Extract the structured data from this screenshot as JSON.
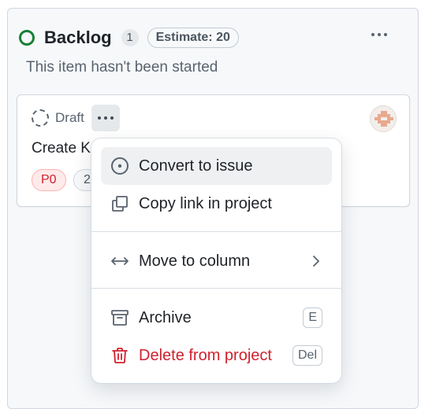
{
  "column": {
    "title": "Backlog",
    "count": "1",
    "estimate": "Estimate: 20",
    "description": "This item hasn't been started",
    "status_color": "#1a7f37"
  },
  "card": {
    "type_label": "Draft",
    "title": "Create K",
    "labels": [
      {
        "text": "P0",
        "color": "#cf222e"
      },
      {
        "text": "2"
      }
    ]
  },
  "menu": {
    "items": [
      {
        "label": "Convert to issue",
        "icon": "issue-opened-icon"
      },
      {
        "label": "Copy link in project",
        "icon": "copy-icon"
      },
      {
        "label": "Move to column",
        "icon": "arrow-both-icon",
        "trailing_icon": "chevron-right-icon"
      },
      {
        "label": "Archive",
        "icon": "archive-icon",
        "shortcut": "E"
      },
      {
        "label": "Delete from project",
        "icon": "trash-icon",
        "shortcut": "Del",
        "color": "#cf222e"
      }
    ]
  }
}
